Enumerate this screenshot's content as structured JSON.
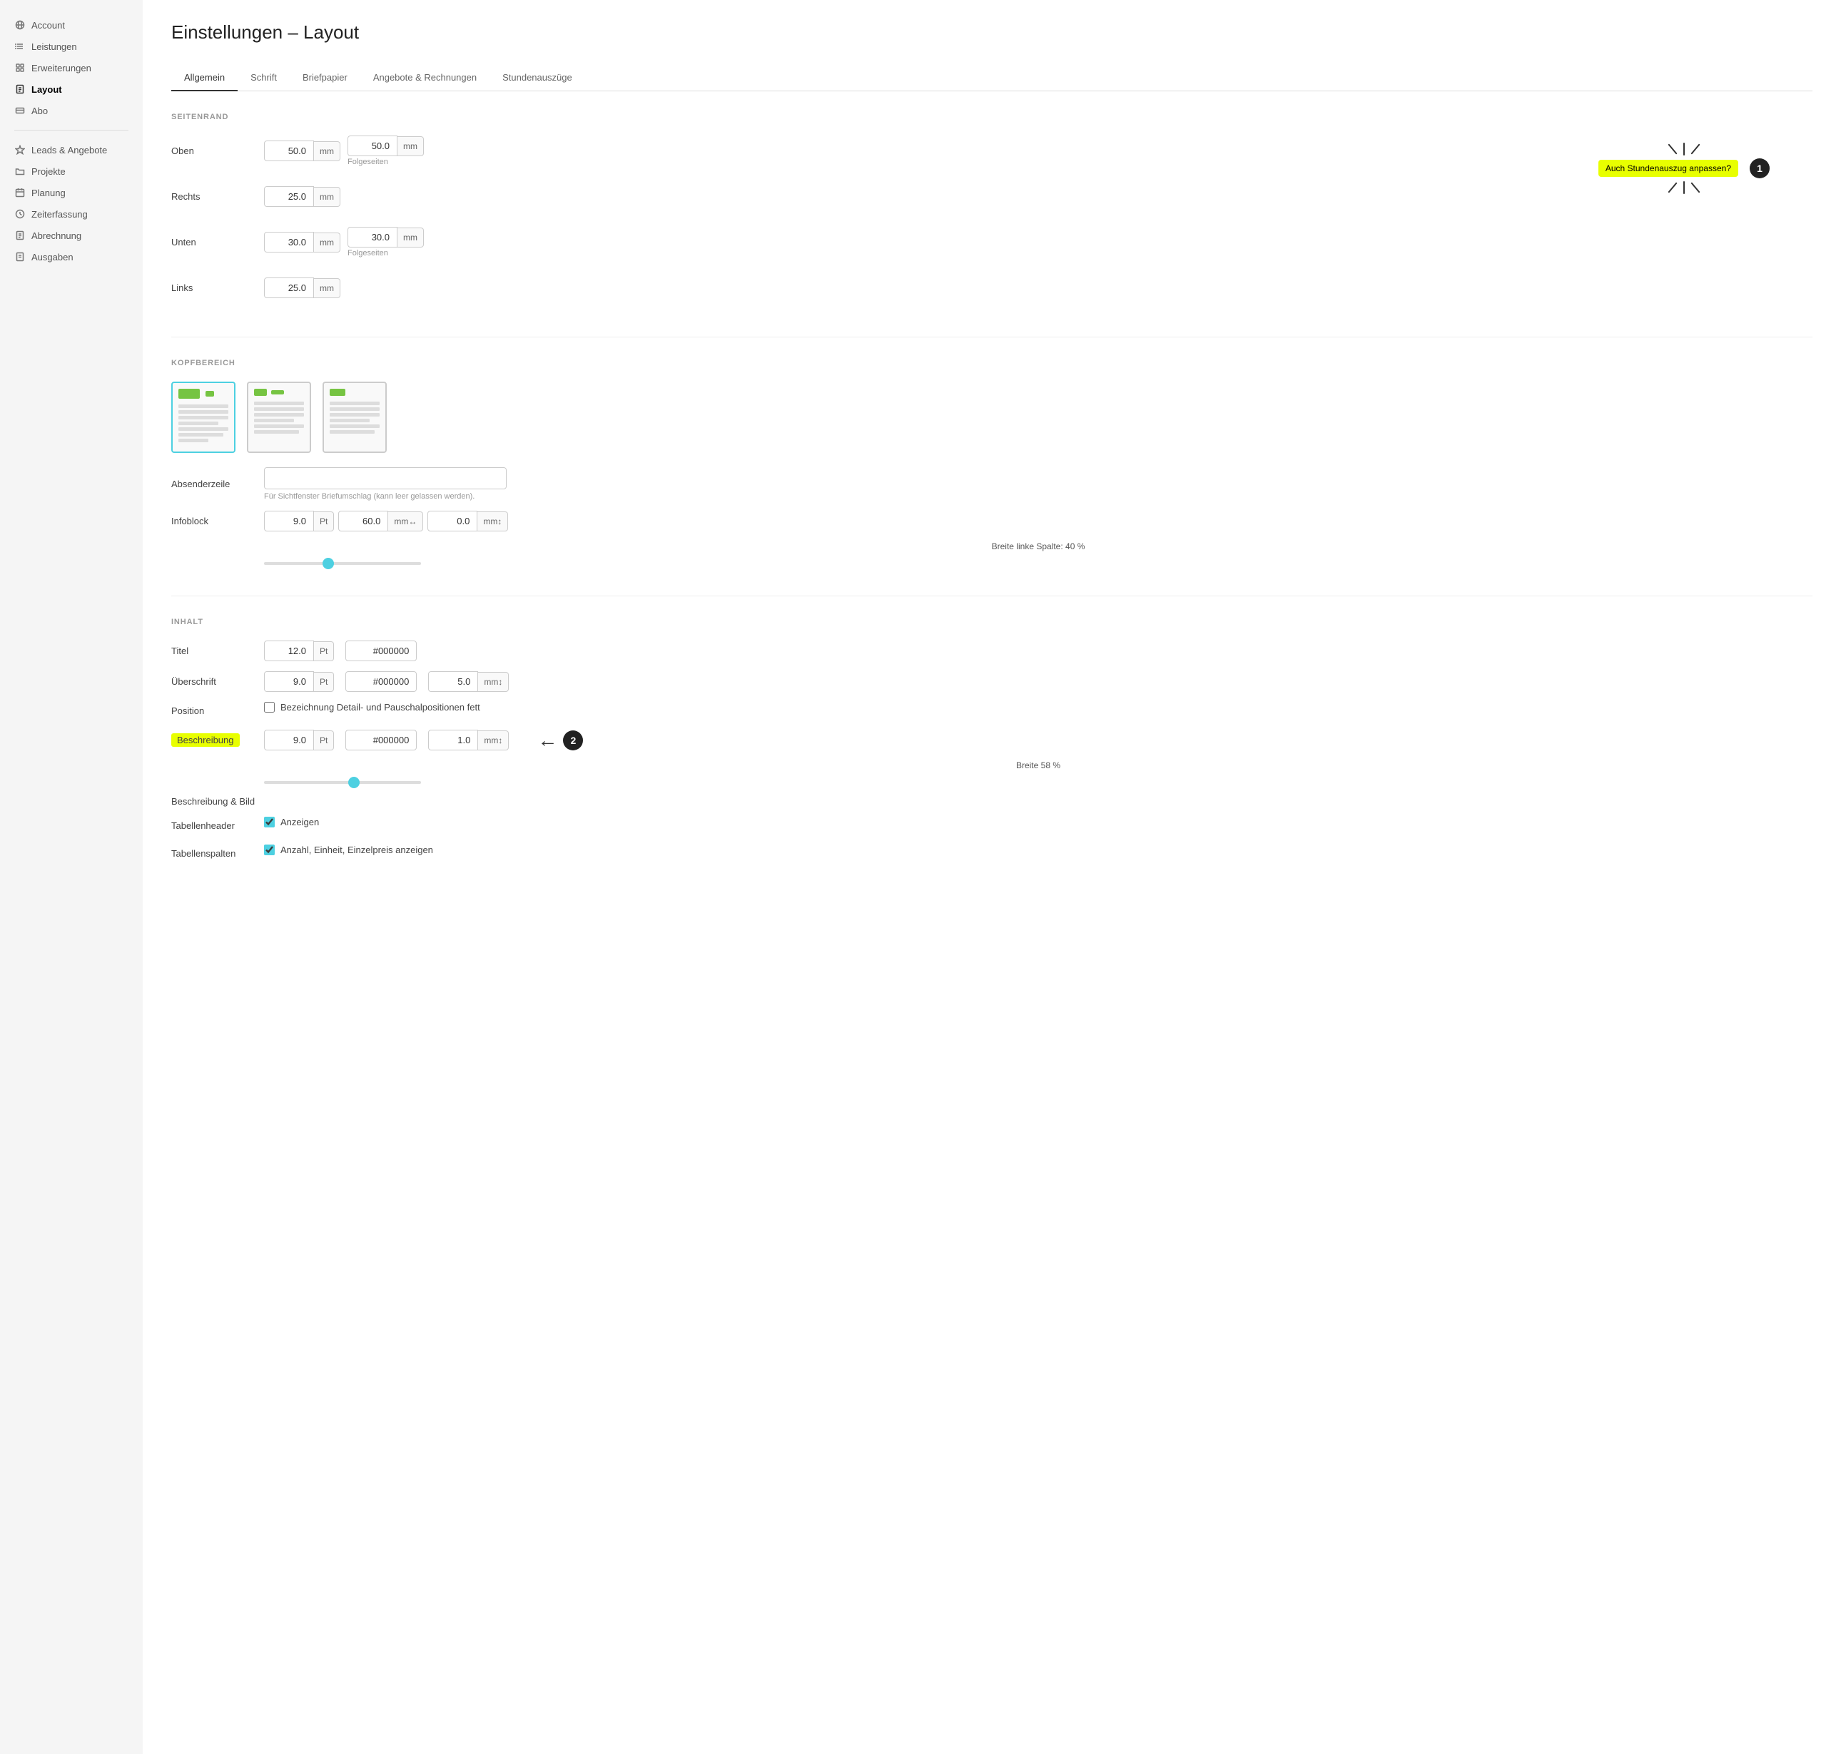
{
  "sidebar": {
    "top_items": [
      {
        "id": "account",
        "label": "Account",
        "icon": "globe"
      },
      {
        "id": "leistungen",
        "label": "Leistungen",
        "icon": "list"
      },
      {
        "id": "erweiterungen",
        "label": "Erweiterungen",
        "icon": "puzzle"
      },
      {
        "id": "layout",
        "label": "Layout",
        "icon": "file",
        "active": true
      },
      {
        "id": "abo",
        "label": "Abo",
        "icon": "card"
      }
    ],
    "bottom_items": [
      {
        "id": "leads",
        "label": "Leads & Angebote",
        "icon": "star"
      },
      {
        "id": "projekte",
        "label": "Projekte",
        "icon": "folder"
      },
      {
        "id": "planung",
        "label": "Planung",
        "icon": "calendar"
      },
      {
        "id": "zeiterfassung",
        "label": "Zeiterfassung",
        "icon": "clock"
      },
      {
        "id": "abrechnung",
        "label": "Abrechnung",
        "icon": "document"
      },
      {
        "id": "ausgaben",
        "label": "Ausgaben",
        "icon": "document2"
      }
    ]
  },
  "page": {
    "title": "Einstellungen – Layout"
  },
  "tabs": [
    {
      "id": "allgemein",
      "label": "Allgemein",
      "active": true
    },
    {
      "id": "schrift",
      "label": "Schrift"
    },
    {
      "id": "briefpapier",
      "label": "Briefpapier"
    },
    {
      "id": "angebote",
      "label": "Angebote & Rechnungen"
    },
    {
      "id": "stunden",
      "label": "Stundenauszüge"
    }
  ],
  "seitenrand": {
    "title": "SEITENRAND",
    "rows": [
      {
        "label": "Oben",
        "value1": "50.0",
        "unit1": "mm",
        "value2": "50.0",
        "unit2": "mm",
        "folgeseiten": true
      },
      {
        "label": "Rechts",
        "value1": "25.0",
        "unit1": "mm"
      },
      {
        "label": "Unten",
        "value1": "30.0",
        "unit1": "mm",
        "value2": "30.0",
        "unit2": "mm",
        "folgeseiten": true
      },
      {
        "label": "Links",
        "value1": "25.0",
        "unit1": "mm"
      }
    ],
    "folgeseiten_label": "Folgeseiten",
    "callout_text": "Auch Stundenauszug anpassen?",
    "callout_badge": "1"
  },
  "kopfbereich": {
    "title": "KOPFBEREICH",
    "absenderzeile_label": "Absenderzeile",
    "absenderzeile_value": "",
    "absenderzeile_hint": "Für Sichtfenster Briefumschlag (kann leer gelassen werden).",
    "infoblock_label": "Infoblock",
    "infoblock_val1": "9.0",
    "infoblock_unit1": "Pt",
    "infoblock_val2": "60.0",
    "infoblock_icon1": "mm↔",
    "infoblock_val3": "0.0",
    "infoblock_icon2": "mm↕",
    "slider_label": "Breite linke Spalte: 40 %",
    "slider_value": 40
  },
  "inhalt": {
    "title": "INHALT",
    "titel_label": "Titel",
    "titel_val": "12.0",
    "titel_unit": "Pt",
    "titel_color": "#000000",
    "ueberschrift_label": "Überschrift",
    "ueberschrift_val": "9.0",
    "ueberschrift_unit": "Pt",
    "ueberschrift_color": "#000000",
    "ueberschrift_val2": "5.0",
    "ueberschrift_unit2": "mm↕",
    "position_label": "Position",
    "position_checkbox": "Bezeichnung Detail- und Pauschalpositionen fett",
    "beschreibung_label": "Beschreibung",
    "beschreibung_val": "9.0",
    "beschreibung_unit": "Pt",
    "beschreibung_color": "#000000",
    "beschreibung_val2": "1.0",
    "beschreibung_unit2": "mm↕",
    "arrow_badge": "2",
    "breite_label": "Breite 58 %",
    "breite_slider_value": 58,
    "beschreibung_bild_label": "Beschreibung & Bild",
    "tabellenheader_label": "Tabellenheader",
    "tabellenheader_checked": true,
    "tabellenheader_text": "Anzeigen",
    "tabellenspalten_label": "Tabellenspalten",
    "tabellenspalten_checked": true,
    "tabellenspalten_text": "Anzahl, Einheit, Einzelpreis anzeigen"
  }
}
